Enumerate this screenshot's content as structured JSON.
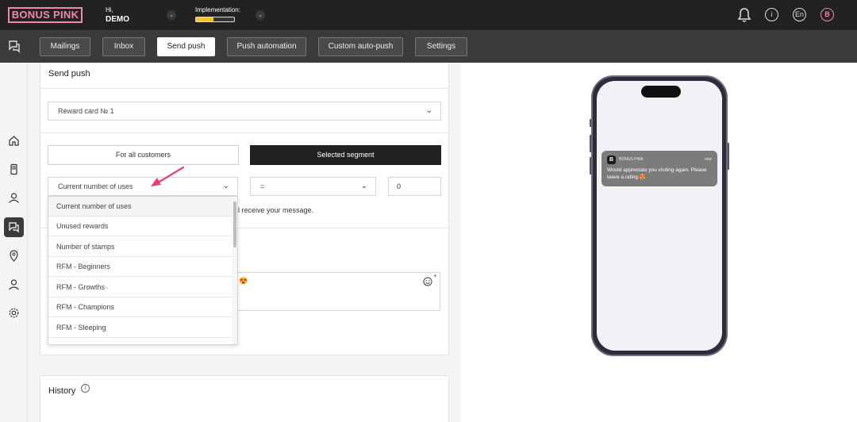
{
  "colors": {
    "brand_pink": "#f08aa6",
    "dark": "#222222",
    "toolbar": "#3b3b3b",
    "progress": "#f1c232",
    "annotation_arrow": "#e8406e"
  },
  "header": {
    "logo": "BONUS PINK",
    "greeting": "Hi,",
    "user_name": "DEMO",
    "implementation_label": "Implementation:",
    "implementation_progress": 0.45,
    "lang": "En",
    "avatar_letter": "B",
    "icons": [
      "chevron-down-icon",
      "bell-icon",
      "info-icon",
      "language-icon",
      "avatar-icon"
    ]
  },
  "tabs": [
    {
      "label": "Mailings"
    },
    {
      "label": "Inbox"
    },
    {
      "label": "Send push",
      "active": true
    },
    {
      "label": "Push automation"
    },
    {
      "label": "Custom auto-push"
    },
    {
      "label": "Settings"
    }
  ],
  "sidebar": {
    "icons": [
      "home-icon",
      "card-icon",
      "customers-icon",
      "chat-icon",
      "location-icon",
      "user-icon",
      "gear-icon"
    ],
    "active": "chat-icon"
  },
  "send_push": {
    "title": "Send push",
    "card_select": "Reward card № 1",
    "audience_all": "For all customers",
    "audience_segment": "Selected segment",
    "condition_field": "Current number of uses",
    "operator": "=",
    "value": "0",
    "receive_text": "ll receive your message.",
    "dropdown_options": [
      "Current number of uses",
      "Unused rewards",
      "Number of stamps",
      "RFM - Beginners",
      "RFM - Growths",
      "RFM - Champions",
      "RFM - Sleeping"
    ]
  },
  "history": {
    "title": "History"
  },
  "preview": {
    "app_name": "BONUS PINK",
    "app_icon_letter": "B",
    "time": "now",
    "message": "Would appreciate you visiting again. Please leave a rating 😍"
  }
}
